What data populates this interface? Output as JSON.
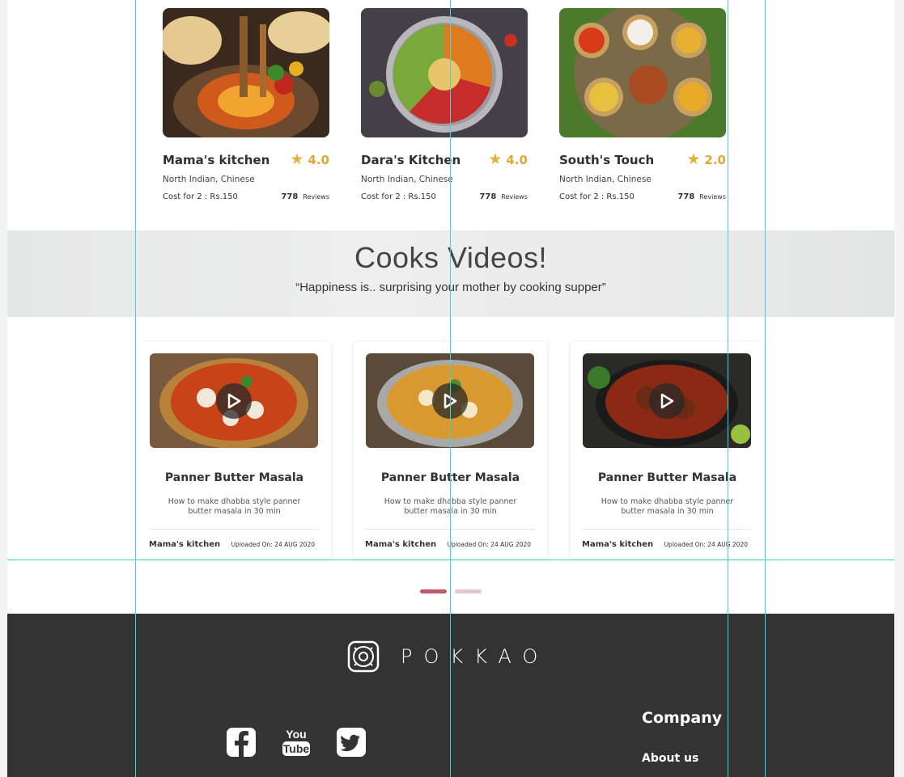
{
  "restaurants": [
    {
      "name": "Mama's kitchen",
      "rating": "4.0",
      "cuisine": "North Indian, Chinese",
      "cost": "Cost for 2 : Rs.150",
      "review_count": "778",
      "review_label": "Reviews"
    },
    {
      "name": "Dara's Kitchen",
      "rating": "4.0",
      "cuisine": "North Indian, Chinese",
      "cost": "Cost for 2 : Rs.150",
      "review_count": "778",
      "review_label": "Reviews"
    },
    {
      "name": "South's Touch",
      "rating": "2.0",
      "cuisine": "North Indian, Chinese",
      "cost": "Cost for 2 : Rs.150",
      "review_count": "778",
      "review_label": "Reviews"
    }
  ],
  "videos_section": {
    "title": "Cooks Videos!",
    "quote": "“Happiness is.. surprising your mother by cooking supper”"
  },
  "videos": [
    {
      "title": "Panner Butter Masala",
      "description": "How to make dhabba style panner butter masala in 30 min",
      "author": "Mama's kitchen",
      "uploaded": "Uploaded On: 24 AUG 2020"
    },
    {
      "title": "Panner Butter Masala",
      "description": "How to make dhabba style panner butter masala in 30 min",
      "author": "Mama's kitchen",
      "uploaded": "Uploaded On: 24 AUG 2020"
    },
    {
      "title": "Panner Butter Masala",
      "description": "How to make dhabba style panner butter masala in 30 min",
      "author": "Mama's kitchen",
      "uploaded": "Uploaded On: 24 AUG 2020"
    }
  ],
  "pager": {
    "active_page": 1,
    "page_count": 2
  },
  "footer": {
    "logo_text": "POKKAO",
    "social": [
      "facebook-icon",
      "youtube-icon",
      "twitter-icon"
    ],
    "company_heading": "Company",
    "links": [
      "About us"
    ]
  },
  "colors": {
    "accent": "#c6566a",
    "star": "#e6b13a",
    "footer_bg": "#333333",
    "guide": "#3ad6e6"
  }
}
